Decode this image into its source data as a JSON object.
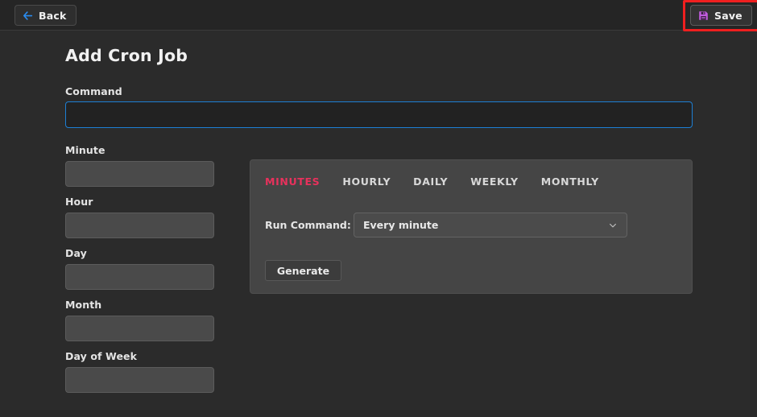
{
  "topbar": {
    "back_label": "Back",
    "save_label": "Save",
    "back_icon": "arrow-left-icon",
    "save_icon": "floppy-disk-save-icon",
    "back_icon_color": "#2a8cf0",
    "save_icon_color": "#c25ce0",
    "annotation_color": "#ef1f1f"
  },
  "page": {
    "title": "Add Cron Job"
  },
  "command": {
    "label": "Command",
    "value": "",
    "placeholder": "",
    "focus_border_color": "#1d7fd4"
  },
  "cron_fields": [
    {
      "label": "Minute",
      "value": "",
      "placeholder": ""
    },
    {
      "label": "Hour",
      "value": "",
      "placeholder": ""
    },
    {
      "label": "Day",
      "value": "",
      "placeholder": ""
    },
    {
      "label": "Month",
      "value": "",
      "placeholder": ""
    },
    {
      "label": "Day of Week",
      "value": "",
      "placeholder": ""
    }
  ],
  "generator": {
    "tabs": [
      {
        "label": "MINUTES",
        "active": true
      },
      {
        "label": "HOURLY",
        "active": false
      },
      {
        "label": "DAILY",
        "active": false
      },
      {
        "label": "WEEKLY",
        "active": false
      },
      {
        "label": "MONTHLY",
        "active": false
      }
    ],
    "active_tab_color": "#e8315c",
    "run_command_label": "Run Command:",
    "schedule_selected": "Every minute",
    "schedule_chevron_icon": "chevron-down-icon",
    "generate_label": "Generate"
  }
}
